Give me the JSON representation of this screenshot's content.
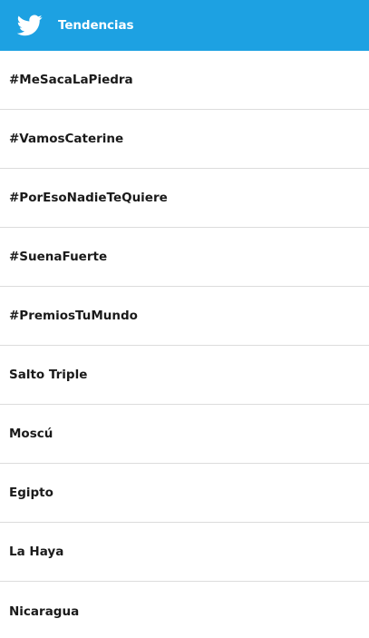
{
  "header": {
    "icon": "twitter-bird-icon",
    "title": "Tendencias",
    "background": "#1da1e2"
  },
  "trends": [
    {
      "label": "#MeSacaLaPiedra"
    },
    {
      "label": "#VamosCaterine"
    },
    {
      "label": "#PorEsoNadieTeQuiere"
    },
    {
      "label": "#SuenaFuerte"
    },
    {
      "label": "#PremiosTuMundo"
    },
    {
      "label": "Salto Triple"
    },
    {
      "label": "Moscú"
    },
    {
      "label": "Egipto"
    },
    {
      "label": "La Haya"
    },
    {
      "label": "Nicaragua"
    }
  ]
}
